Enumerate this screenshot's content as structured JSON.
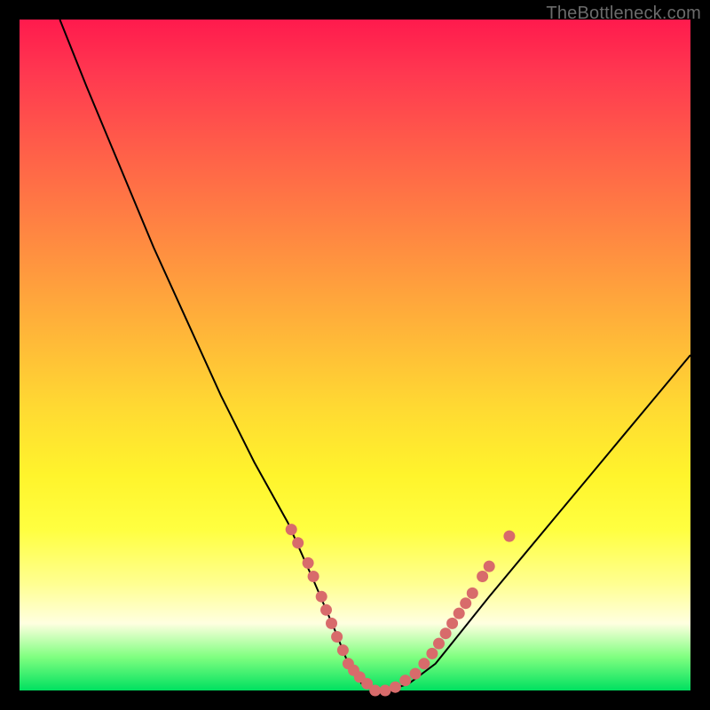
{
  "watermark": "TheBottleneck.com",
  "colors": {
    "background_frame": "#000000",
    "curve": "#000000",
    "dot": "#d86b6b",
    "gradient_top": "#ff1a4d",
    "gradient_bottom": "#00e060"
  },
  "chart_data": {
    "type": "line",
    "title": "",
    "xlabel": "",
    "ylabel": "",
    "xlim": [
      0,
      100
    ],
    "ylim": [
      0,
      100
    ],
    "series": [
      {
        "name": "bottleneck-curve",
        "x": [
          6,
          10,
          15,
          20,
          25,
          30,
          35,
          40,
          44,
          47,
          49,
          51,
          53,
          55,
          58,
          62,
          66,
          70,
          75,
          80,
          85,
          90,
          95,
          100
        ],
        "y": [
          100,
          90,
          78,
          66,
          55,
          44,
          34,
          25,
          16,
          9,
          4,
          1,
          0,
          0,
          1,
          4,
          9,
          14,
          20,
          26,
          32,
          38,
          44,
          50
        ]
      }
    ],
    "points": [
      {
        "x": 40.5,
        "y": 24
      },
      {
        "x": 41.5,
        "y": 22
      },
      {
        "x": 43.0,
        "y": 19
      },
      {
        "x": 43.8,
        "y": 17
      },
      {
        "x": 45.0,
        "y": 14
      },
      {
        "x": 45.7,
        "y": 12
      },
      {
        "x": 46.5,
        "y": 10
      },
      {
        "x": 47.3,
        "y": 8
      },
      {
        "x": 48.2,
        "y": 6
      },
      {
        "x": 49.0,
        "y": 4
      },
      {
        "x": 49.8,
        "y": 3
      },
      {
        "x": 50.7,
        "y": 2
      },
      {
        "x": 51.8,
        "y": 1
      },
      {
        "x": 53.0,
        "y": 0
      },
      {
        "x": 54.5,
        "y": 0
      },
      {
        "x": 56.0,
        "y": 0.5
      },
      {
        "x": 57.5,
        "y": 1.5
      },
      {
        "x": 59.0,
        "y": 2.5
      },
      {
        "x": 60.3,
        "y": 4
      },
      {
        "x": 61.5,
        "y": 5.5
      },
      {
        "x": 62.5,
        "y": 7
      },
      {
        "x": 63.5,
        "y": 8.5
      },
      {
        "x": 64.5,
        "y": 10
      },
      {
        "x": 65.5,
        "y": 11.5
      },
      {
        "x": 66.5,
        "y": 13
      },
      {
        "x": 67.5,
        "y": 14.5
      },
      {
        "x": 69.0,
        "y": 17
      },
      {
        "x": 70.0,
        "y": 18.5
      },
      {
        "x": 73.0,
        "y": 23
      }
    ]
  }
}
